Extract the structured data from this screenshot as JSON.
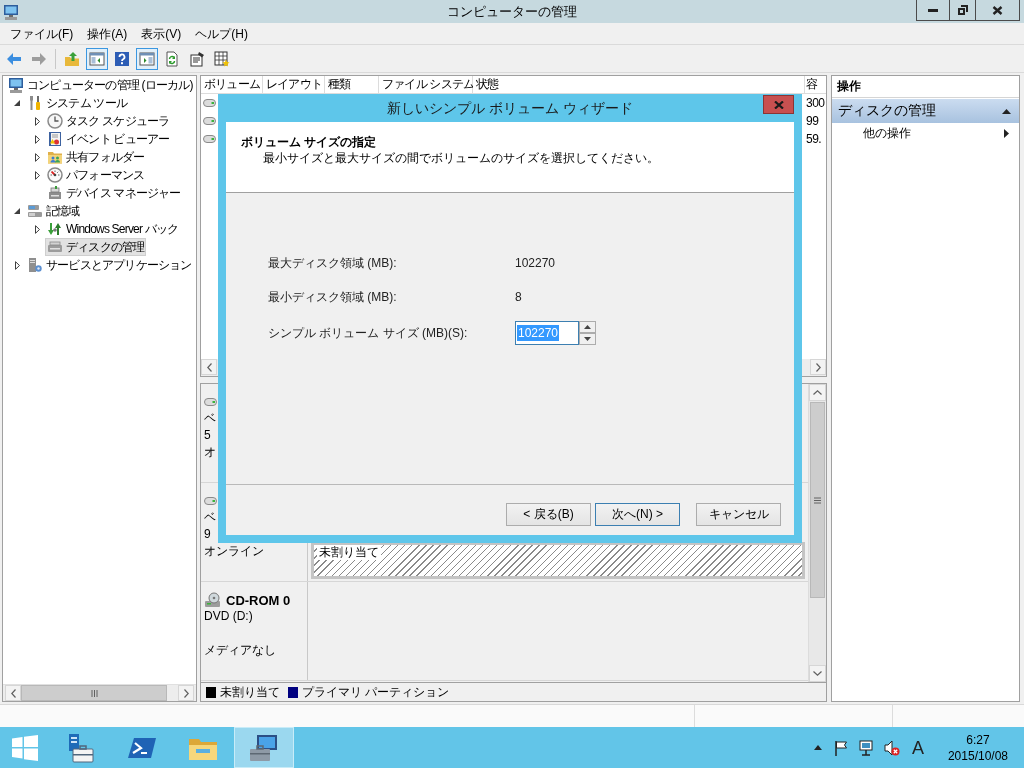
{
  "window": {
    "title": "コンピューターの管理"
  },
  "menu": [
    {
      "label": "ファイル(F)"
    },
    {
      "label": "操作(A)"
    },
    {
      "label": "表示(V)"
    },
    {
      "label": "ヘルプ(H)"
    }
  ],
  "toolbar": [
    [
      {
        "kind": "back",
        "disabled": false,
        "pressed": false
      },
      {
        "kind": "forward",
        "disabled": true,
        "pressed": false
      }
    ],
    [
      {
        "kind": "up-folder",
        "disabled": false,
        "pressed": false
      },
      {
        "kind": "console-tree",
        "disabled": false,
        "pressed": true
      },
      {
        "kind": "help",
        "disabled": false,
        "pressed": false
      },
      {
        "kind": "action-pane",
        "disabled": false,
        "pressed": true
      },
      {
        "kind": "refresh",
        "disabled": false,
        "pressed": false
      },
      {
        "kind": "properties",
        "disabled": false,
        "pressed": false
      },
      {
        "kind": "export",
        "disabled": false,
        "pressed": false
      }
    ]
  ],
  "tree": [
    {
      "label": "コンピューターの管理 (ローカル)",
      "kind": "computer",
      "selected": false,
      "children": [
        {
          "label": "システム ツール",
          "kind": "tools",
          "expanded": true,
          "selected": false,
          "children": [
            {
              "label": "タスク スケジューラ",
              "kind": "clock",
              "expanded": false,
              "selected": false
            },
            {
              "label": "イベント ビューアー",
              "kind": "event-log",
              "expanded": false,
              "selected": false
            },
            {
              "label": "共有フォルダー",
              "kind": "shared-folder",
              "expanded": false,
              "selected": false
            },
            {
              "label": "パフォーマンス",
              "kind": "performance",
              "expanded": false,
              "selected": false
            },
            {
              "label": "デバイス マネージャー",
              "kind": "device-manager",
              "selected": false
            }
          ]
        },
        {
          "label": "記憶域",
          "kind": "storage",
          "expanded": true,
          "selected": false,
          "children": [
            {
              "label": "Windows Server バック",
              "kind": "backup",
              "expanded": false,
              "selected": false
            },
            {
              "label": "ディスクの管理",
              "kind": "disk-management",
              "selected": true
            }
          ]
        },
        {
          "label": "サービスとアプリケーション",
          "kind": "services",
          "expanded": false,
          "selected": false
        }
      ]
    }
  ],
  "volume_list": {
    "columns": [
      "ボリューム",
      "レイアウト",
      "種類",
      "ファイル システム",
      "状態",
      "容"
    ],
    "rows": [
      {
        "capacity": "300"
      },
      {
        "capacity": "99"
      },
      {
        "capacity": "59."
      }
    ]
  },
  "disks": [
    {
      "kind": "basic",
      "type": "ベ",
      "size": "5",
      "status": "オ"
    },
    {
      "kind": "basic",
      "type": "ベ",
      "size": "9",
      "status": "オンライン",
      "partitions": [
        {
          "kind": "unallocated",
          "label": "未割り当て"
        }
      ]
    },
    {
      "kind": "cdrom",
      "name": "CD-ROM 0",
      "type": "DVD (D:)",
      "status": "メディアなし"
    }
  ],
  "legend": [
    {
      "label": "未割り当て",
      "color": "#000000"
    },
    {
      "label": "プライマリ パーティション",
      "color": "#000080"
    }
  ],
  "actions": {
    "title": "操作",
    "sections": [
      {
        "label": "ディスクの管理",
        "expanded": true,
        "items": [
          {
            "label": "他の操作"
          }
        ]
      }
    ]
  },
  "dialog": {
    "title": "新しいシンプル ボリューム ウィザード",
    "heading": "ボリューム サイズの指定",
    "description": "最小サイズと最大サイズの間でボリュームのサイズを選択してください。",
    "fields": [
      {
        "kind": "readonly",
        "label": "最大ディスク領域 (MB):",
        "value": "102270"
      },
      {
        "kind": "readonly",
        "label": "最小ディスク領域 (MB):",
        "value": "8"
      },
      {
        "kind": "spinner",
        "label": "シンプル ボリューム サイズ (MB)(S):",
        "value": "102270",
        "highlighted": true
      }
    ],
    "buttons": [
      {
        "label": "< 戻る(B)",
        "focused": false
      },
      {
        "label": "次へ(N) >",
        "focused": true
      },
      {
        "label": "キャンセル",
        "focused": false
      }
    ]
  },
  "taskbar": {
    "apps": [
      {
        "kind": "server-manager",
        "active": false
      },
      {
        "kind": "powershell",
        "active": false
      },
      {
        "kind": "file-explorer",
        "active": false
      },
      {
        "kind": "computer-management",
        "active": true
      }
    ],
    "tray": {
      "ime": "A",
      "time": "6:27",
      "date": "2015/10/08"
    }
  }
}
